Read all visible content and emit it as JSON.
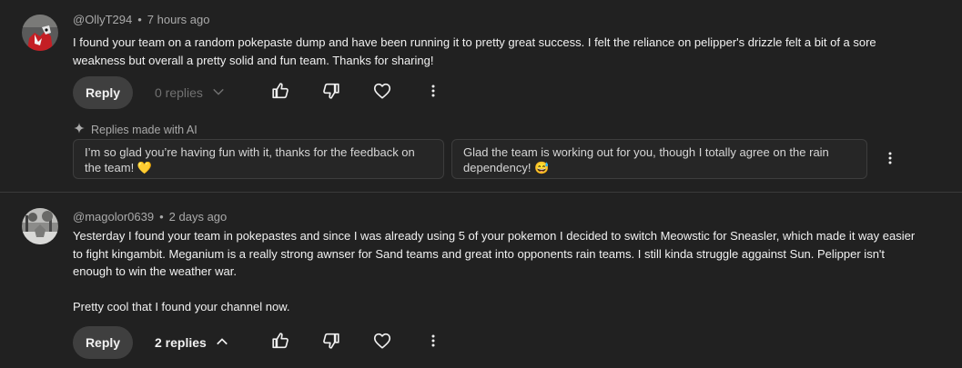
{
  "comments": [
    {
      "author": "@OllyT294",
      "time": "7 hours ago",
      "paragraphs": [
        "I found your team on a random pokepaste dump and have been running it to pretty great success. I felt the reliance on pelipper's drizzle felt a bit of a sore weakness but overall a pretty solid and fun team. Thanks for sharing!"
      ],
      "reply_label": "Reply",
      "replies_label": "0 replies",
      "ai": {
        "label": "Replies made with AI",
        "suggestions": [
          "I’m so glad you’re having fun with it, thanks for the feedback on the team! 💛",
          "Glad the team is working out for you, though I totally agree on the rain dependency! 😅"
        ]
      }
    },
    {
      "author": "@magolor0639",
      "time": "2 days ago",
      "paragraphs": [
        "Yesterday I found your team in pokepastes and since I was already using 5 of your pokemon I decided to switch Meowstic for Sneasler, which made it way easier to fight kingambit. Meganium is a really strong awnser for Sand teams and great into opponents rain teams. I still kinda struggle aggainst Sun. Pelipper isn't enough to win the weather war.",
        "Pretty cool that I found your channel now."
      ],
      "reply_label": "Reply",
      "replies_label": "2 replies"
    }
  ],
  "icons": {
    "like": "thumbs-up-icon",
    "dislike": "thumbs-down-icon",
    "heart": "heart-icon",
    "more": "more-vert-icon",
    "ai": "sparkle-icon",
    "chevron_down": "chevron-down-icon",
    "chevron_up": "chevron-up-icon"
  },
  "colors": {
    "background": "#212121",
    "text": "#f1f1f1",
    "secondary_text": "#aaaaaa",
    "button_bg": "#3f3f3f",
    "chip_border": "#3d3d3d"
  }
}
